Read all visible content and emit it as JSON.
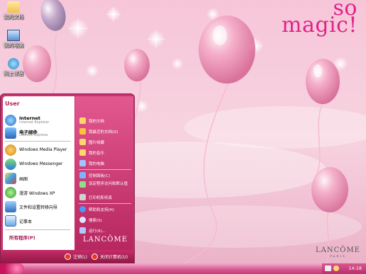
{
  "desktop": {
    "icons": [
      {
        "label": "我的文档",
        "icon": "my-documents-icon"
      },
      {
        "label": "我的电脑",
        "icon": "my-computer-icon"
      },
      {
        "label": "网上邻居",
        "icon": "network-places-icon"
      }
    ],
    "brand_line1": "so",
    "brand_line2": "magic!",
    "brand_footer": "LANCÔME",
    "brand_footer_sub": "PARIS"
  },
  "start_menu": {
    "user": "User",
    "pinned": [
      {
        "title": "Internet",
        "subtitle": "Internet Explorer",
        "icon": "internet-explorer-icon"
      },
      {
        "title": "电子邮件",
        "subtitle": "Outlook Express",
        "icon": "outlook-express-icon"
      }
    ],
    "recent": [
      {
        "title": "Windows Media Player",
        "icon": "media-player-icon"
      },
      {
        "title": "Windows Messenger",
        "icon": "messenger-icon"
      },
      {
        "title": "画图",
        "icon": "paint-icon"
      },
      {
        "title": "漫游 Windows XP",
        "icon": "xp-tour-icon"
      },
      {
        "title": "文件和设置转移向导",
        "icon": "transfer-wizard-icon"
      },
      {
        "title": "记事本",
        "icon": "notepad-icon"
      }
    ],
    "all_programs": "所有程序(P)",
    "right_items": [
      {
        "title": "我的文档",
        "icon": "my-documents-icon"
      },
      {
        "title": "我最近的文档(D)",
        "icon": "recent-documents-icon"
      },
      {
        "title": "图片收藏",
        "icon": "my-pictures-icon"
      },
      {
        "title": "我的音乐",
        "icon": "my-music-icon"
      },
      {
        "title": "我的电脑",
        "icon": "my-computer-icon"
      },
      {
        "title": "控制面板(C)",
        "icon": "control-panel-icon"
      },
      {
        "title": "设定程序访问和默认值",
        "icon": "program-defaults-icon"
      },
      {
        "title": "打印机和传真",
        "icon": "printers-icon"
      },
      {
        "title": "帮助和支持(H)",
        "icon": "help-icon"
      },
      {
        "title": "搜索(S)",
        "icon": "search-icon"
      },
      {
        "title": "运行(R)...",
        "icon": "run-icon"
      }
    ],
    "brand": "LANCÔME",
    "logoff": "注销(L)",
    "shutdown": "关闭计算机(U)"
  },
  "taskbar": {
    "clock": "14:18",
    "accent": "#c9346f"
  }
}
